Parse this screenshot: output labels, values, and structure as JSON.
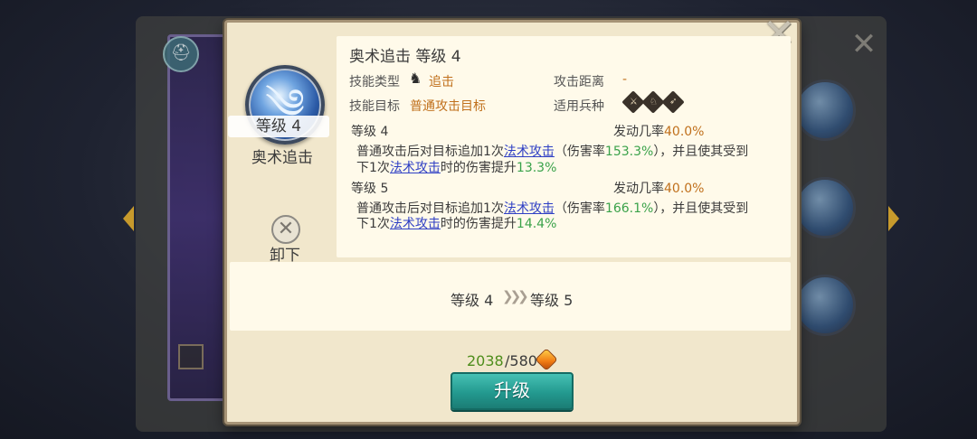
{
  "dialog": {
    "title": "奥术追击 等级 4",
    "left": {
      "level_badge": "等级 4",
      "skill_name": "奥术追击",
      "unequip_label": "卸下"
    },
    "info": {
      "type_label": "技能类型",
      "type_value": "追击",
      "range_label": "攻击距离",
      "range_value": "-",
      "target_label": "技能目标",
      "target_value": "普通攻击目标",
      "unit_label": "适用兵种"
    },
    "levels": [
      {
        "heading": "等级 4",
        "trigger_label": "发动几率",
        "trigger_value": "40.0%",
        "line1_a": "普通攻击后对目标追加1次",
        "line1_link": "法术攻击",
        "line1_b": "（伤害率",
        "line1_rate": "153.3%",
        "line1_c": "），并且使其受到",
        "line2_a": "下1次",
        "line2_link": "法术攻击",
        "line2_b": "时的伤害提升",
        "line2_value": "13.3%"
      },
      {
        "heading": "等级 5",
        "trigger_label": "发动几率",
        "trigger_value": "40.0%",
        "line1_a": "普通攻击后对目标追加1次",
        "line1_link": "法术攻击",
        "line1_b": "（伤害率",
        "line1_rate": "166.1%",
        "line1_c": "），并且使其受到",
        "line2_a": "下1次",
        "line2_link": "法术攻击",
        "line2_b": "时的伤害提升",
        "line2_value": "14.4%"
      }
    ],
    "upgrade_preview": {
      "from": "等级 4",
      "arrows": "❯❯❯",
      "to": "等级 5"
    },
    "cost": {
      "have": "2038",
      "need": "/580"
    },
    "upgrade_button": "升级",
    "close_symbol": "✕"
  },
  "icons": {
    "skill": "arcane-pursuit-skill-icon",
    "type": "pursuit-type-icon",
    "units": [
      "infantry-icon",
      "cavalry-icon",
      "archer-icon"
    ],
    "gem": "orange-gem-icon"
  },
  "colors": {
    "accent_button": "#23998f",
    "link": "#2e3fc4",
    "highlight_green": "#3aa24a",
    "highlight_orange": "#c0701c"
  }
}
